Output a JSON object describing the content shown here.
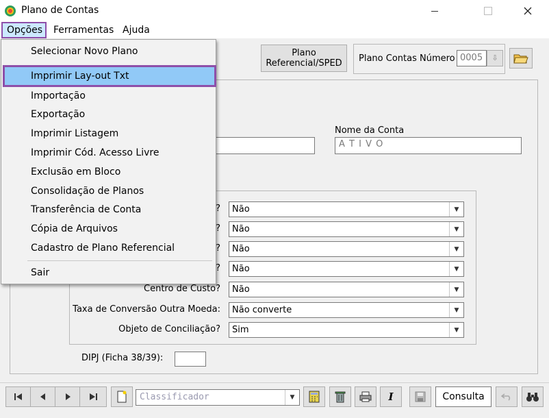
{
  "window": {
    "title": "Plano de Contas",
    "minimize_icon": "minimize-icon",
    "maximize_icon": "maximize-icon",
    "close_icon": "close-icon"
  },
  "menubar": {
    "items": [
      "Opções",
      "Ferramentas",
      "Ajuda"
    ]
  },
  "opcoes_menu": {
    "items": [
      "Selecionar Novo Plano",
      "Imprimir Lay-out Txt",
      "Importação",
      "Exportação",
      "Imprimir Listagem",
      "Imprimir Cód. Acesso Livre",
      "Exclusão em Bloco",
      "Consolidação de Planos",
      "Transferência de Conta",
      "Cópia de Arquivos",
      "Cadastro de Plano Referencial",
      "Sair"
    ],
    "highlighted": "Imprimir Lay-out Txt"
  },
  "header": {
    "plano_ref_button": [
      "Plano",
      "Referencial/SPED"
    ],
    "plano_numero_label": "Plano Contas Número",
    "plano_numero_value": "0005"
  },
  "conta": {
    "nome_label": "Nome da Conta",
    "nome_value": "A T I V O"
  },
  "options": {
    "rows": [
      {
        "label": "?",
        "value": "Não"
      },
      {
        "label": "?",
        "value": "Não"
      },
      {
        "label": "?",
        "value": "Não"
      },
      {
        "label": "?",
        "value": "Não"
      },
      {
        "label": "Centro de Custo?",
        "value": "Não"
      },
      {
        "label": "Taxa de Conversão Outra Moeda:",
        "value": "Não converte"
      },
      {
        "label": "Objeto de Conciliação?",
        "value": "Sim"
      }
    ]
  },
  "dipj": {
    "label": "DIPJ (Ficha 38/39):",
    "value": ""
  },
  "toolbar": {
    "classificador_placeholder": "Classificador",
    "consulta_label": "Consulta",
    "italic_label": "I"
  },
  "colors": {
    "menu_highlight_border": "#8e4fa9",
    "menu_highlight_fill": "#91c9f7"
  }
}
